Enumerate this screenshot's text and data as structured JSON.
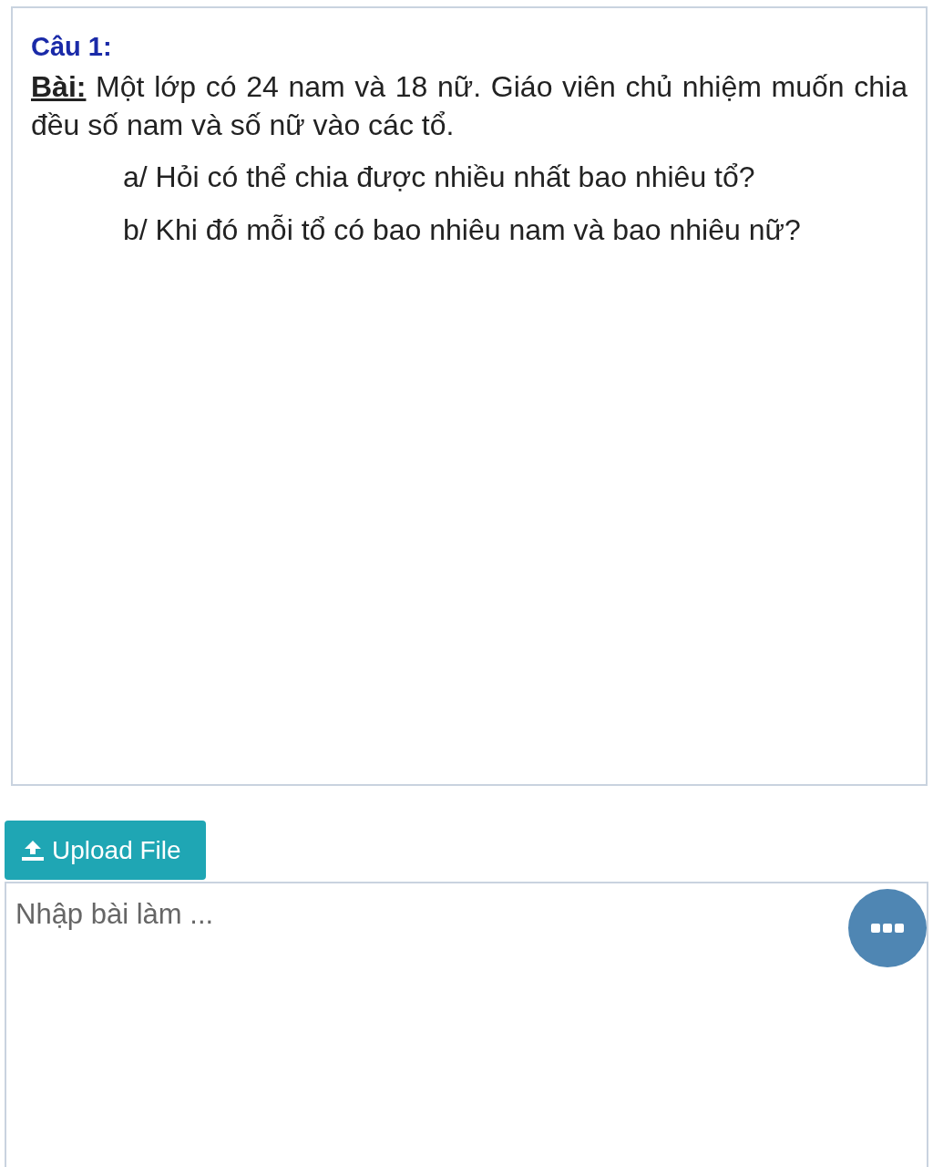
{
  "question": {
    "title": "Câu 1:",
    "label": "Bài:",
    "text": "Một lớp có 24 nam và 18 nữ. Giáo viên chủ nhiệm muốn chia đều số nam và số nữ vào các tổ.",
    "parts": [
      "a/ Hỏi có thể chia được nhiều nhất bao nhiêu tổ?",
      "b/ Khi đó mỗi tổ có bao nhiêu nam và bao nhiêu nữ?"
    ]
  },
  "upload_button": {
    "label": "Upload File"
  },
  "answer": {
    "placeholder": "Nhập bài làm ..."
  }
}
